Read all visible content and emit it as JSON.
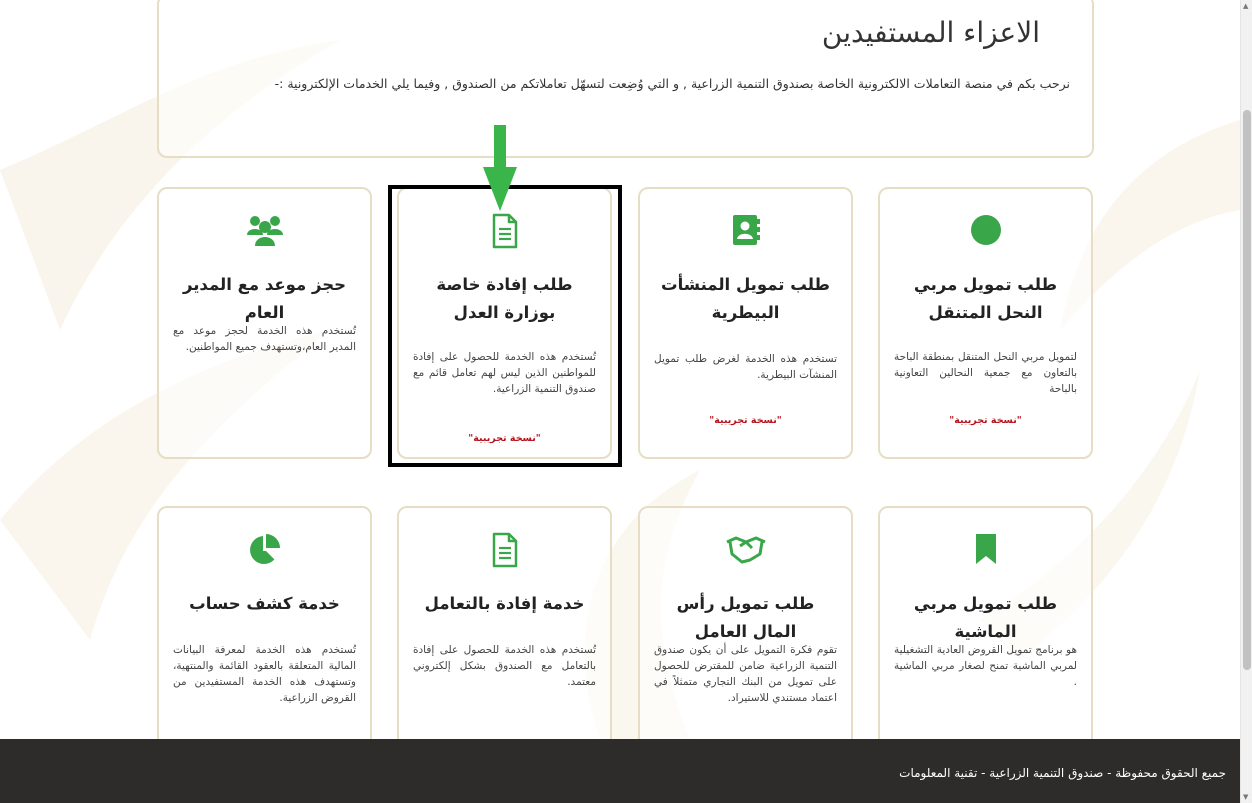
{
  "welcome": {
    "title": "الاعزاء المستفيدين",
    "intro": "نرحب بكم في منصة التعاملات الالكترونية الخاصة بصندوق التنمية الزراعية , و التي وُضِعت لتسهّل تعاملاتكم من الصندوق , وفيما يلي الخدمات الإلكترونية :-"
  },
  "accent_color": "#3aa64a",
  "cards": [
    {
      "icon": "circle-icon",
      "title": "طلب تمويل مربي النحل المتنقل",
      "desc": "لتمويل مربي النحل المتنقل بمنطقة الباحة بالتعاون مع جمعية النحالين التعاونية بالباحة",
      "badge": "\"نسخة تجريبية\""
    },
    {
      "icon": "contact-book-icon",
      "title": "طلب تمويل المنشأت البيطرية",
      "desc": "تستخدم هذه الخدمة لغرض طلب تمويل المنشآت البيطرية.",
      "badge": "\"نسخة تجريبية\""
    },
    {
      "icon": "document-icon",
      "title": "طلب إفادة خاصة بوزارة العدل",
      "desc": "تُستخدم هذه الخدمة للحصول على إفادة للمواطنين الذين ليس لهم تعامل قائم مع صندوق التنمية الزراعية.",
      "badge": "\"نسخة تجريبية\""
    },
    {
      "icon": "users-group-icon",
      "title": "حجز موعد مع المدير العام",
      "desc": "تُستخدم هذه الخدمة لحجز موعد مع المدير العام،وتستهدف جميع المواطنين.",
      "badge": ""
    },
    {
      "icon": "bookmark-icon",
      "title": "طلب تمويل مربي الماشية",
      "desc": "هو برنامج تمويل القروض العادية التشغيلية لمربي الماشية تمنح لصغار مربي الماشية .",
      "badge": ""
    },
    {
      "icon": "handshake-icon",
      "title": "طلب تمويل رأس المال العامل",
      "desc": "تقوم فكرة التمويل على أن يكون صندوق التنمية الزراعية ضامن للمقترض للحصول على تمويل من البنك التجاري متمثلاً في اعتماد مستندي للاستيراد.",
      "badge": ""
    },
    {
      "icon": "document-icon",
      "title": "خدمة إفادة بالتعامل",
      "desc": "تُستخدم هذه الخدمة للحصول على إفادة بالتعامل مع الصندوق بشكل إلكتروني معتمد.",
      "badge": ""
    },
    {
      "icon": "pie-chart-icon",
      "title": "خدمة كشف حساب",
      "desc": "تُستخدم هذه الخدمة لمعرفة البيانات المالية المتعلقة بالعقود القائمة والمنتهية، وتستهدف هذه الخدمة المستفيدين من القروض الزراعية.",
      "badge": ""
    }
  ],
  "footer": {
    "text": "جميع الحقوق محفوظة - صندوق التنمية الزراعية - تقنية المعلومات"
  }
}
